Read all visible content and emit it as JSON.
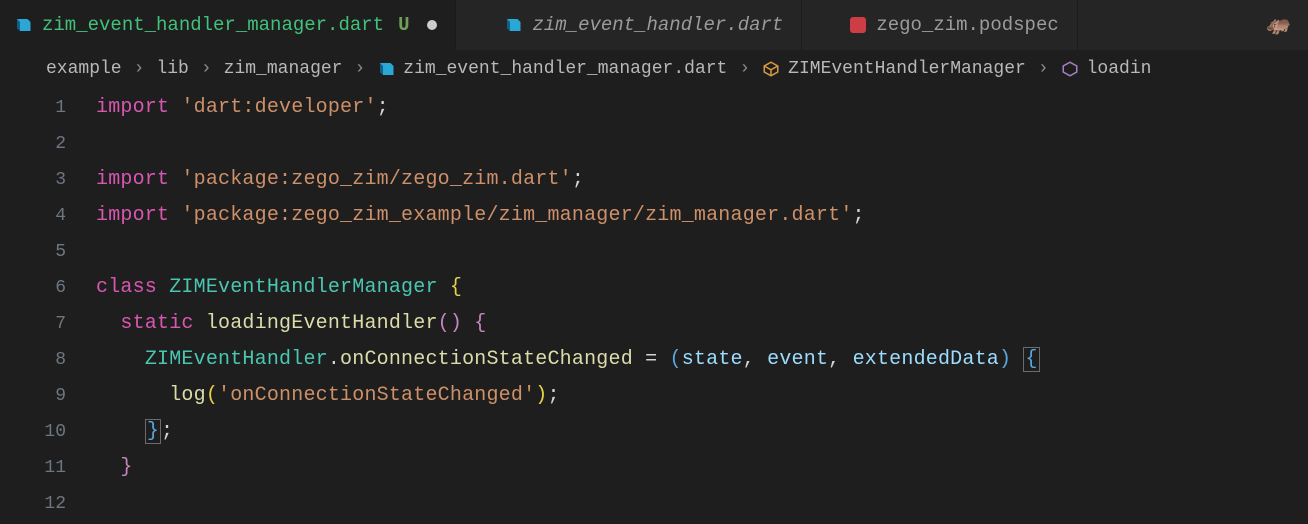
{
  "tabs": [
    {
      "label": "zim_event_handler_manager.dart",
      "status": "U",
      "active": true,
      "modified": true,
      "icon": "dart"
    },
    {
      "label": "zim_event_handler.dart",
      "active": false,
      "icon": "dart"
    },
    {
      "label": "zego_zim.podspec",
      "active": false,
      "icon": "podspec"
    }
  ],
  "breadcrumbs": {
    "items": [
      {
        "label": "example",
        "icon": null
      },
      {
        "label": "lib",
        "icon": null
      },
      {
        "label": "zim_manager",
        "icon": null
      },
      {
        "label": "zim_event_handler_manager.dart",
        "icon": "dart"
      },
      {
        "label": "ZIMEventHandlerManager",
        "icon": "class"
      },
      {
        "label": "loadin",
        "icon": "method"
      }
    ],
    "sep": "›"
  },
  "colors": {
    "keyword": "#d857b0",
    "string": "#cd9069",
    "class": "#49c7b1",
    "function": "#dcdcaa",
    "param": "#9cdcfe",
    "background": "#1e1e1e"
  },
  "code": {
    "lines": [
      {
        "n": "1",
        "tokens": [
          {
            "t": "import ",
            "c": "kw"
          },
          {
            "t": "'dart:developer'",
            "c": "str"
          },
          {
            "t": ";",
            "c": "punc"
          }
        ]
      },
      {
        "n": "2",
        "tokens": []
      },
      {
        "n": "3",
        "tokens": [
          {
            "t": "import ",
            "c": "kw"
          },
          {
            "t": "'package:zego_zim/zego_zim.dart'",
            "c": "str"
          },
          {
            "t": ";",
            "c": "punc"
          }
        ]
      },
      {
        "n": "4",
        "tokens": [
          {
            "t": "import ",
            "c": "kw"
          },
          {
            "t": "'package:zego_zim_example/zim_manager/zim_manager.dart'",
            "c": "str"
          },
          {
            "t": ";",
            "c": "punc"
          }
        ]
      },
      {
        "n": "5",
        "tokens": []
      },
      {
        "n": "6",
        "tokens": [
          {
            "t": "class ",
            "c": "kw"
          },
          {
            "t": "ZIMEventHandlerManager",
            "c": "cls"
          },
          {
            "t": " ",
            "c": "op"
          },
          {
            "t": "{",
            "c": "brace-y"
          }
        ]
      },
      {
        "n": "7",
        "indent": 1,
        "tokens": [
          {
            "t": "static ",
            "c": "kw"
          },
          {
            "t": "loadingEventHandler",
            "c": "fn"
          },
          {
            "t": "()",
            "c": "brace-p"
          },
          {
            "t": " ",
            "c": "op"
          },
          {
            "t": "{",
            "c": "brace-p"
          }
        ]
      },
      {
        "n": "8",
        "indent": 2,
        "tokens": [
          {
            "t": "ZIMEventHandler",
            "c": "cls"
          },
          {
            "t": ".",
            "c": "punc"
          },
          {
            "t": "onConnectionStateChanged",
            "c": "fn"
          },
          {
            "t": " = ",
            "c": "op"
          },
          {
            "t": "(",
            "c": "brace-b"
          },
          {
            "t": "state",
            "c": "prop"
          },
          {
            "t": ", ",
            "c": "punc"
          },
          {
            "t": "event",
            "c": "prop"
          },
          {
            "t": ", ",
            "c": "punc"
          },
          {
            "t": "extendedData",
            "c": "prop"
          },
          {
            "t": ")",
            "c": "brace-b"
          },
          {
            "t": " ",
            "c": "op"
          },
          {
            "t": "{",
            "c": "bracket-box"
          }
        ]
      },
      {
        "n": "9",
        "indent": 3,
        "tokens": [
          {
            "t": "log",
            "c": "fn"
          },
          {
            "t": "(",
            "c": "brace-y"
          },
          {
            "t": "'onConnectionStateChanged'",
            "c": "str"
          },
          {
            "t": ")",
            "c": "brace-y"
          },
          {
            "t": ";",
            "c": "punc"
          }
        ]
      },
      {
        "n": "10",
        "indent": 2,
        "tokens": [
          {
            "t": "}",
            "c": "bracket-box"
          },
          {
            "t": ";",
            "c": "punc"
          }
        ]
      },
      {
        "n": "11",
        "indent": 1,
        "tokens": [
          {
            "t": "}",
            "c": "brace-p"
          }
        ]
      },
      {
        "n": "12",
        "tokens": []
      }
    ]
  }
}
